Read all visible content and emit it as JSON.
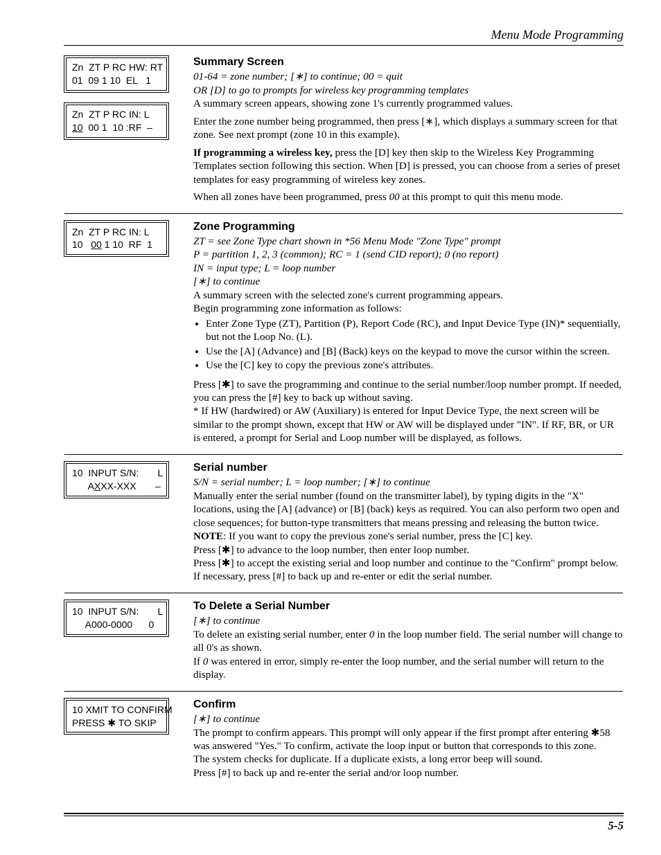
{
  "header": {
    "title": "Menu Mode Programming"
  },
  "footer": {
    "page": "5-5"
  },
  "sec1": {
    "lcd1": "Zn  ZT P RC HW: RT\n01  09 1 10  EL   1",
    "lcd2_pre": "Zn  ZT P RC IN: L\n",
    "lcd2_u": "10",
    "lcd2_post": "  00 1  10 :RF  –",
    "title": "Summary Screen",
    "line1": "01-64 = zone number; [∗] to continue; 00 = quit",
    "line2": "OR  [D] to go to prompts for wireless key programming templates",
    "p1": "A summary screen appears, showing zone 1's currently programmed  values.",
    "p2": "Enter the zone number being programmed, then press [∗], which displays a summary screen for that zone. See next prompt (zone 10 in this example).",
    "p3a": "If programming a wireless key,",
    "p3b": " press the [D] key then skip to the Wireless Key Programming Templates section following this section. When [D] is pressed, you can choose from a series of preset templates for easy programming of wireless key zones.",
    "p4a": "When all zones have been programmed, press ",
    "p4b": "00",
    "p4c": " at this prompt to quit this menu mode."
  },
  "sec2": {
    "lcd_pre": "Zn  ZT P RC IN: L\n10   ",
    "lcd_u": "00",
    "lcd_post": " 1 10  RF  1",
    "title": "Zone Programming",
    "l1": "ZT = see Zone Type chart shown in *56 Menu Mode \"Zone Type\" prompt",
    "l2": "P =  partition 1, 2, 3 (common); RC = 1 (send CID report); 0 (no report)",
    "l3": "IN =  input type; L = loop number",
    "l4": "[∗] to continue",
    "p1": "A summary screen with the selected zone's current programming appears.",
    "p2": "Begin programming zone information as follows:",
    "b1": "Enter Zone Type (ZT), Partition (P), Report Code (RC), and Input Device Type (IN)* sequentially, but not the Loop No. (L).",
    "b2": "Use the [A] (Advance) and [B] (Back) keys on the keypad to move the cursor within the screen.",
    "b3": "Use the [C] key to copy the previous zone's attributes.",
    "p3": "Press [✱] to save the programming and continue to the serial number/loop number prompt. If needed, you can press the [#] key to back up without saving.",
    "p4": "* If HW (hardwired) or AW (Auxiliary) is entered for Input Device Type, the next screen will be similar to the prompt shown, except that HW or AW will be displayed under \"IN\". If RF, BR, or UR is entered, a prompt for Serial and Loop number will be displayed, as follows."
  },
  "sec3": {
    "lcd_l1": "10  INPUT S/N:       L",
    "lcd_l2_pre": "      A",
    "lcd_l2_u": "X",
    "lcd_l2_post": "XX-XXX       –",
    "title": "Serial number",
    "l1": "S/N = serial number; L = loop number; [∗] to continue",
    "p1": "Manually enter the serial number (found on the transmitter label), by typing digits in the \"X\" locations, using the [A] (advance) or [B] (back) keys as required. You can also perform two open and close sequences; for button-type transmitters that means pressing and releasing the button twice.",
    "note_lbl": "NOTE",
    "note_txt": ": If you want to copy the previous zone's serial number, press the [C] key.",
    "p2": "Press [✱] to advance to the loop number, then enter loop number.",
    "p3": "Press [✱] to accept the existing serial and loop number and continue to the \"Confirm\" prompt below. If necessary, press [#] to back up and re-enter or edit the serial number."
  },
  "sec4": {
    "lcd": "10  INPUT S/N:       L\n     A000-0000      0",
    "title": "To Delete a Serial Number",
    "l1": "[∗] to continue",
    "p1a": "To delete an existing serial number, enter ",
    "p1b": "0",
    "p1c": " in the loop number field.  The serial number will change to all 0's as shown.",
    "p2a": "If ",
    "p2b": "0",
    "p2c": " was entered in error, simply re-enter the loop number, and the serial number will return to the display."
  },
  "sec5": {
    "lcd": "10 XMIT TO CONFIRM\nPRESS ✱ TO SKIP",
    "title": "Confirm",
    "l1": "[∗] to continue",
    "p1": "The prompt to confirm appears. This prompt will only appear if the first prompt after entering ✱58 was answered \"Yes.\"  To confirm, activate the loop input or button that corresponds to this zone.",
    "p2": "The system checks for duplicate. If a duplicate exists, a long error beep will sound.",
    "p3": "Press [#] to back up and re-enter the serial and/or loop number."
  }
}
